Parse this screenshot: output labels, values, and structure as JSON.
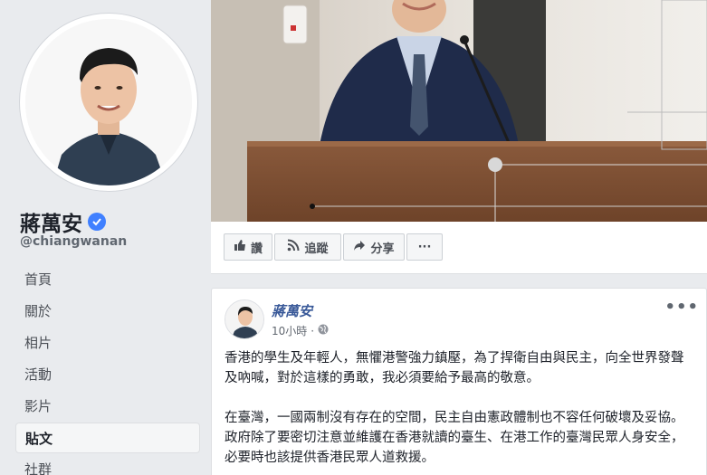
{
  "profile": {
    "name": "蔣萬安",
    "handle": "@chiangwanan"
  },
  "nav": {
    "items": [
      {
        "label": "首頁"
      },
      {
        "label": "關於"
      },
      {
        "label": "相片"
      },
      {
        "label": "活動"
      },
      {
        "label": "影片"
      },
      {
        "label": "貼文"
      },
      {
        "label": "社群"
      }
    ],
    "active_index": 5
  },
  "actions": {
    "like_label": "讚",
    "follow_label": "追蹤",
    "share_label": "分享",
    "more_label": "···"
  },
  "post": {
    "author": "蔣萬安",
    "time": "10小時",
    "more": "•••",
    "paragraphs": [
      "香港的學生及年輕人，無懼港警強力鎮壓，為了捍衛自由與民主，向全世界發聲及吶喊，對於這樣的勇敢，我必須要給予最高的敬意。",
      "在臺灣，一國兩制沒有存在的空間，民主自由憲政體制也不容任何破壞及妥協。政府除了要密切注意並維護在香港就讀的臺生、在港工作的臺灣民眾人身安全，必要時也該提供香港民眾人道救援。"
    ]
  },
  "colors": {
    "link": "#385898",
    "verified": "#4080ff",
    "background": "#e9ebee"
  }
}
